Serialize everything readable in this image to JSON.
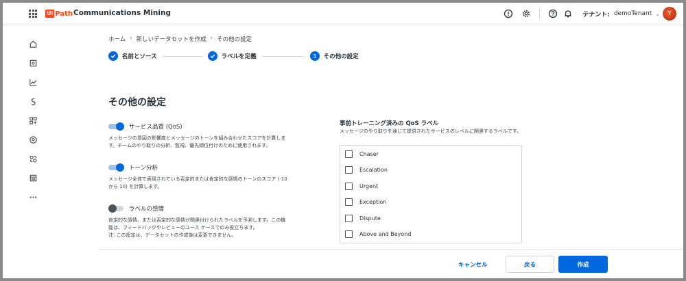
{
  "header": {
    "logo_ui": "Ui",
    "logo_path": "Path",
    "app_name": "Communications Mining",
    "tenant_label": "テナント:",
    "tenant_name": "demoTenant",
    "avatar_initial": "Y"
  },
  "sidebar": {
    "icons": [
      "home-icon",
      "dataset-icon",
      "analytics-icon",
      "sources-icon",
      "integrations-icon",
      "automation-icon",
      "models-icon",
      "storage-icon",
      "more-icon"
    ]
  },
  "breadcrumb": [
    "ホーム",
    "新しいデータセットを作成",
    "その他の設定"
  ],
  "stepper": {
    "steps": [
      {
        "label": "名前とソース",
        "status": "done"
      },
      {
        "label": "ラベルを定義",
        "status": "done"
      },
      {
        "label": "その他の設定",
        "status": "current",
        "number": "3"
      }
    ]
  },
  "page_title": "その他の設定",
  "settings": [
    {
      "label": "サービス品質 (QoS)",
      "enabled": true,
      "description": "メッセージの意図の影響度とメッセージのトーンを組み合わせたスコアを計算します。チームのやり取りの分析、監視、優先順位付けのために使用されます。"
    },
    {
      "label": "トーン分析",
      "enabled": true,
      "description": "メッセージ全体で表現されている否定的または肯定的な感情のトーンのスコア (-10 から 10) を計算します。"
    },
    {
      "label": "ラベルの感情",
      "enabled": false,
      "description": "肯定的な感情、または否定的な感情が関連付けられたラベルを予測します。この機能は、フィードバックやレビューのユース ケースでのみ役立ちます。",
      "note": "注: この設定は、データセットの作成後は変更できません。"
    }
  ],
  "qos": {
    "title": "事前トレーニング済みの QoS ラベル",
    "subtitle": "メッセージのやり取りを通じて提供されたサービスのレベルに関連するラベルです。",
    "items": [
      {
        "label": "Chaser",
        "checked": false
      },
      {
        "label": "Escalation",
        "checked": false
      },
      {
        "label": "Urgent",
        "checked": false
      },
      {
        "label": "Exception",
        "checked": false
      },
      {
        "label": "Dispute",
        "checked": false
      },
      {
        "label": "Above and Beyond",
        "checked": false
      }
    ]
  },
  "footer": {
    "cancel_label": "キャンセル",
    "back_label": "戻る",
    "create_label": "作成"
  },
  "colors": {
    "accent": "#0067df",
    "brand": "#fa4616"
  }
}
